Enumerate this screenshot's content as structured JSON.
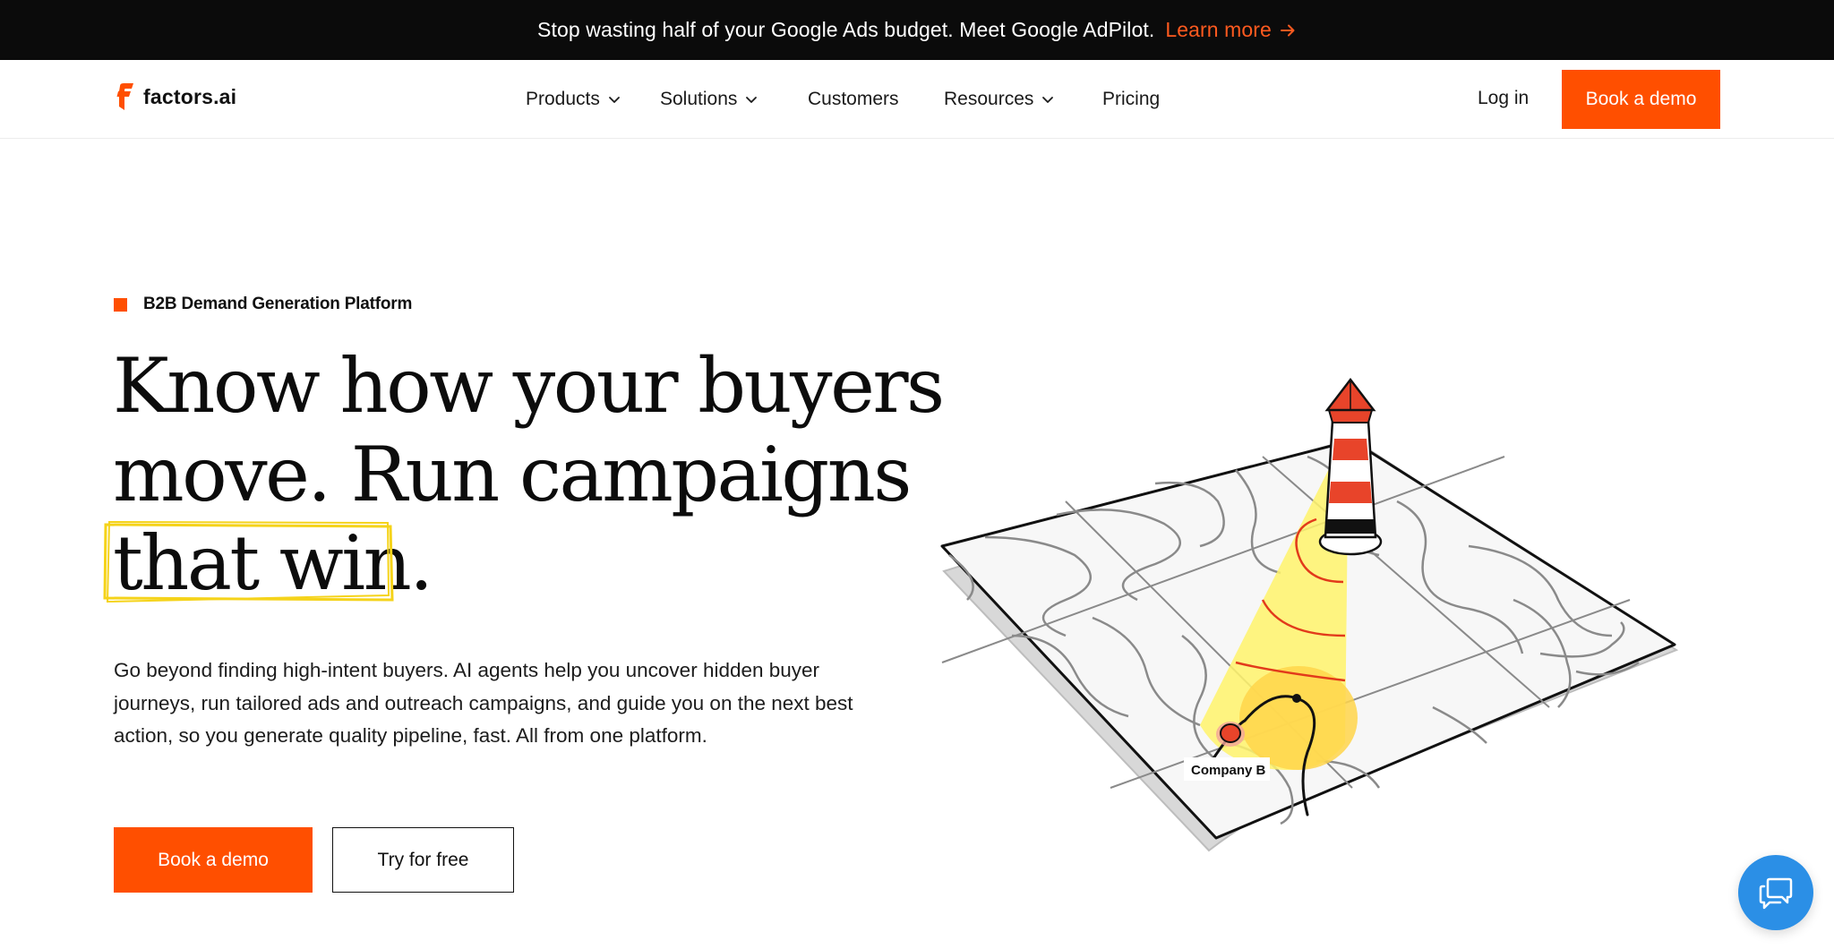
{
  "announcement": {
    "message": "Stop wasting half of your Google Ads budget. Meet Google AdPilot.",
    "link_label": "Learn more",
    "link_icon": "arrow-right-icon",
    "link_color": "#ff5a1f"
  },
  "brand": {
    "name": "factors.ai",
    "accent": "#ff4f00"
  },
  "nav": {
    "items": [
      {
        "label": "Products",
        "has_dropdown": true
      },
      {
        "label": "Solutions",
        "has_dropdown": true
      },
      {
        "label": "Customers",
        "has_dropdown": false
      },
      {
        "label": "Resources",
        "has_dropdown": true
      },
      {
        "label": "Pricing",
        "has_dropdown": false
      }
    ],
    "login_label": "Log in",
    "cta_label": "Book a demo"
  },
  "hero": {
    "eyebrow": "B2B Demand Generation Platform",
    "headline_lines": [
      "Know how your buyers",
      "move. Run campaigns",
      "that win."
    ],
    "subcopy": "Go beyond finding high-intent buyers. AI agents help you uncover hidden buyer journeys, run tailored ads and outreach campaigns, and guide you on the next best action, so you generate quality pipeline, fast. All from one platform.",
    "primary_cta": "Book a demo",
    "secondary_cta": "Try for free",
    "highlight_color": "#f5d31a"
  },
  "illustration": {
    "marker_label": "Company B",
    "icon": "lighthouse-map-illustration"
  },
  "chat_widget": {
    "icon": "chat-bubbles-icon",
    "color": "#2b8fe6"
  }
}
